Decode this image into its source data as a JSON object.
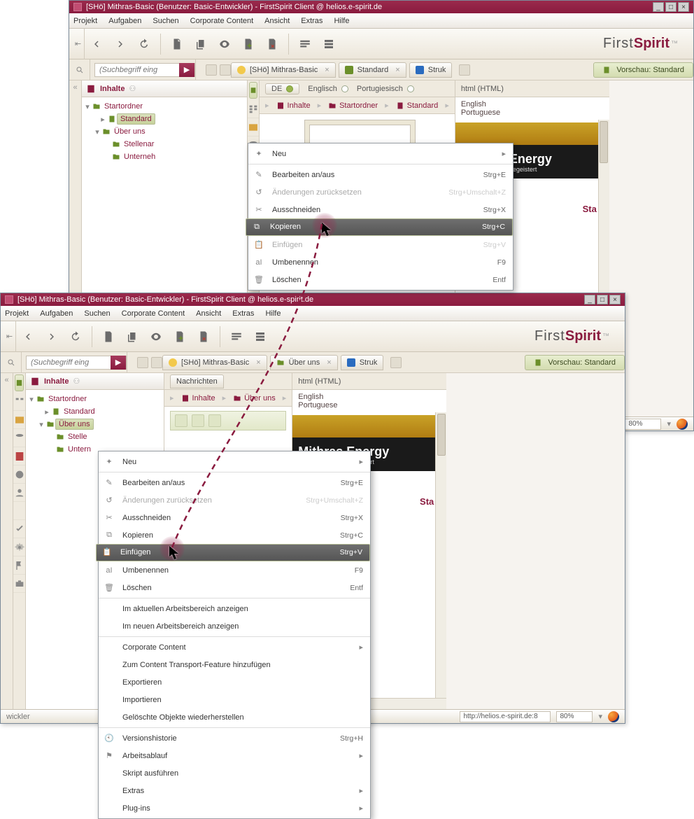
{
  "title": "[SHö] Mithras-Basic (Benutzer: Basic-Entwickler) - FirstSpirit Client @ helios.e-spirit.de",
  "menus": [
    "Projekt",
    "Aufgaben",
    "Suchen",
    "Corporate Content",
    "Ansicht",
    "Extras",
    "Hilfe"
  ],
  "brand": {
    "first": "First",
    "spirit": "Spirit",
    "tm": "™"
  },
  "search_placeholder": "(Suchbegriff eing",
  "nav_header": "Inhalte",
  "preview_label": "Vorschau: Standard",
  "html_tab": "html (HTML)",
  "lang": {
    "de": "DE",
    "en": "Englisch",
    "pt": "Portugiesisch"
  },
  "lang_right": [
    "English",
    "Portuguese"
  ],
  "crumb1": [
    "Inhalte",
    "Startordner",
    "Standard"
  ],
  "crumb2": [
    "Inhalte",
    "Über uns"
  ],
  "tabs1": {
    "proj": "[SHö] Mithras-Basic",
    "mid": "Standard",
    "last": "Struk"
  },
  "tabs2": {
    "proj": "[SHö] Mithras-Basic",
    "mid": "Über uns",
    "last": "Struk"
  },
  "tree1": {
    "root": "Startordner",
    "page": "Standard",
    "folder": "Über uns",
    "leaf1": "Stellenar",
    "leaf2": "Unterneh"
  },
  "tree2": {
    "root": "Startordner",
    "page": "Standard",
    "folder": "Über uns",
    "leaf1": "Stelle",
    "leaf2": "Untern"
  },
  "banner": {
    "title": "Mithras Energy",
    "sub": "Solartechnik, die begeistert"
  },
  "clip": "Sta",
  "nachrichten_btn": "Nachrichten",
  "ctx1": [
    {
      "label": "Neu",
      "sub": true,
      "icon": "new"
    },
    {
      "sep": true
    },
    {
      "label": "Bearbeiten an/aus",
      "short": "Strg+E",
      "icon": "edit"
    },
    {
      "label": "Änderungen zurücksetzen",
      "short": "Strg+Umschalt+Z",
      "icon": "undo",
      "disabled": true
    },
    {
      "label": "Ausschneiden",
      "short": "Strg+X",
      "icon": "cut"
    },
    {
      "label": "Kopieren",
      "short": "Strg+C",
      "icon": "copy",
      "sel": true
    },
    {
      "label": "Einfügen",
      "short": "Strg+V",
      "icon": "paste",
      "disabled": true
    },
    {
      "label": "Umbenennen",
      "short": "F9",
      "icon": "rename"
    },
    {
      "label": "Löschen",
      "short": "Entf",
      "icon": "trash"
    }
  ],
  "ctx2": [
    {
      "label": "Neu",
      "sub": true,
      "icon": "new"
    },
    {
      "sep": true
    },
    {
      "label": "Bearbeiten an/aus",
      "short": "Strg+E",
      "icon": "edit"
    },
    {
      "label": "Änderungen zurücksetzen",
      "short": "Strg+Umschalt+Z",
      "icon": "undo",
      "disabled": true
    },
    {
      "label": "Ausschneiden",
      "short": "Strg+X",
      "icon": "cut"
    },
    {
      "label": "Kopieren",
      "short": "Strg+C",
      "icon": "copy"
    },
    {
      "label": "Einfügen",
      "short": "Strg+V",
      "icon": "paste",
      "sel": true
    },
    {
      "label": "Umbenennen",
      "short": "F9",
      "icon": "rename"
    },
    {
      "label": "Löschen",
      "short": "Entf",
      "icon": "trash"
    },
    {
      "sep": true
    },
    {
      "label": "Im aktuellen Arbeitsbereich anzeigen"
    },
    {
      "label": "Im neuen Arbeitsbereich anzeigen"
    },
    {
      "sep": true
    },
    {
      "label": "Corporate Content",
      "sub": true
    },
    {
      "label": "Zum Content Transport-Feature hinzufügen"
    },
    {
      "label": "Exportieren"
    },
    {
      "label": "Importieren"
    },
    {
      "label": "Gelöschte Objekte wiederherstellen"
    },
    {
      "sep": true
    },
    {
      "label": "Versionshistorie",
      "short": "Strg+H",
      "icon": "history"
    },
    {
      "label": "Arbeitsablauf",
      "sub": true,
      "icon": "flag"
    },
    {
      "label": "Skript ausführen"
    },
    {
      "label": "Extras",
      "sub": true
    },
    {
      "label": "Plug-ins",
      "sub": true
    }
  ],
  "footer": {
    "status": "wickler",
    "url": "http://helios.e-spirit.de:8",
    "zoom": "80%"
  },
  "footer1_zoom": "80%"
}
